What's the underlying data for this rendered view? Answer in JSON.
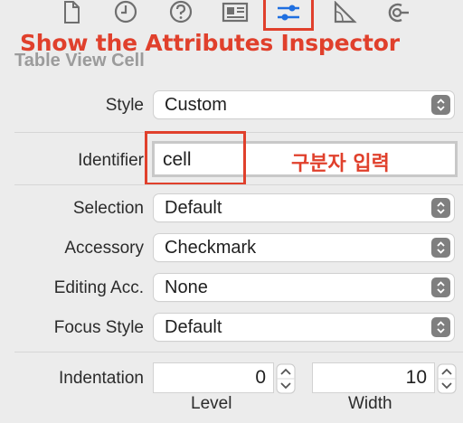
{
  "toolbar": {
    "icons": [
      {
        "name": "file-inspector-icon"
      },
      {
        "name": "history-inspector-icon"
      },
      {
        "name": "quick-help-icon"
      },
      {
        "name": "identity-inspector-icon"
      },
      {
        "name": "attributes-inspector-icon",
        "selected": true
      },
      {
        "name": "size-inspector-icon"
      },
      {
        "name": "connections-inspector-icon"
      }
    ]
  },
  "annotations": {
    "title": "Show the Attributes Inspector",
    "identifier_note": "구분자 입력",
    "color": "#e0402c"
  },
  "inspector": {
    "section_title": "Table View Cell",
    "style": {
      "label": "Style",
      "value": "Custom"
    },
    "identifier": {
      "label": "Identifier",
      "value": "cell"
    },
    "selection": {
      "label": "Selection",
      "value": "Default"
    },
    "accessory": {
      "label": "Accessory",
      "value": "Checkmark"
    },
    "editing_accessory": {
      "label": "Editing Acc.",
      "value": "None"
    },
    "focus_style": {
      "label": "Focus Style",
      "value": "Default"
    },
    "indentation": {
      "label": "Indentation",
      "level": {
        "value": "0",
        "label": "Level"
      },
      "width": {
        "value": "10",
        "label": "Width"
      }
    }
  }
}
